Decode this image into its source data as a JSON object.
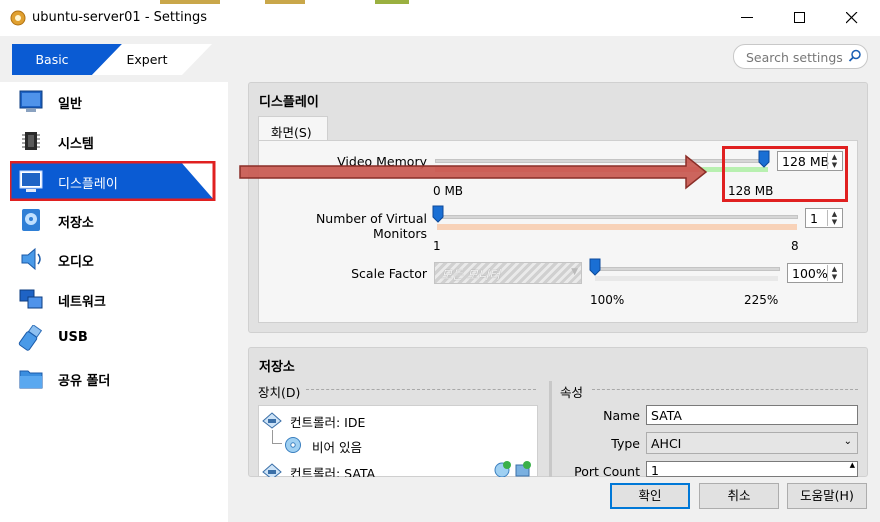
{
  "window": {
    "title": "ubuntu-server01 - Settings"
  },
  "mode": {
    "basic": "Basic",
    "expert": "Expert"
  },
  "search": {
    "placeholder": "Search settings"
  },
  "sidebar": {
    "items": [
      {
        "label": "일반",
        "icon": "general-icon"
      },
      {
        "label": "시스템",
        "icon": "system-chip-icon"
      },
      {
        "label": "디스플레이",
        "icon": "display-monitor-icon"
      },
      {
        "label": "저장소",
        "icon": "storage-disk-icon"
      },
      {
        "label": "오디오",
        "icon": "audio-speaker-icon"
      },
      {
        "label": "네트워크",
        "icon": "network-icon"
      },
      {
        "label": "USB",
        "icon": "usb-icon"
      },
      {
        "label": "공유 폴더",
        "icon": "shared-folder-icon"
      }
    ],
    "selected_index": 2
  },
  "display": {
    "group_title": "디스플레이",
    "tab": "화면(S)",
    "video_memory": {
      "label": "Video Memory",
      "value": "128 MB",
      "min_label": "0 MB",
      "max_label": "128 MB",
      "fraction": 1.0
    },
    "monitors": {
      "label": "Number of Virtual Monitors",
      "value": "1",
      "min_label": "1",
      "max_label": "8",
      "fraction": 0.0
    },
    "scale": {
      "label": "Scale Factor",
      "combo": "모든 모니터",
      "value": "100%",
      "min_label": "100%",
      "max_label": "225%",
      "fraction": 0.0
    }
  },
  "storage": {
    "group_title": "저장소",
    "devices_label": "장치(D)",
    "attributes_label": "속성",
    "tree": [
      {
        "label": "컨트롤러: IDE",
        "icon": "ide-controller-icon"
      },
      {
        "label": "비어 있음",
        "icon": "optical-disc-icon"
      },
      {
        "label": "컨트롤러: SATA",
        "icon": "sata-controller-icon"
      }
    ],
    "name_label": "Name",
    "name_value": "SATA",
    "type_label": "Type",
    "type_value": "AHCI",
    "port_label": "Port Count",
    "port_value": "1"
  },
  "buttons": {
    "ok": "확인",
    "cancel": "취소",
    "help": "도움말(H)"
  },
  "colors": {
    "accent": "#0a5bd3",
    "highlight_red": "#e02020",
    "arrow": "#c8554d"
  }
}
